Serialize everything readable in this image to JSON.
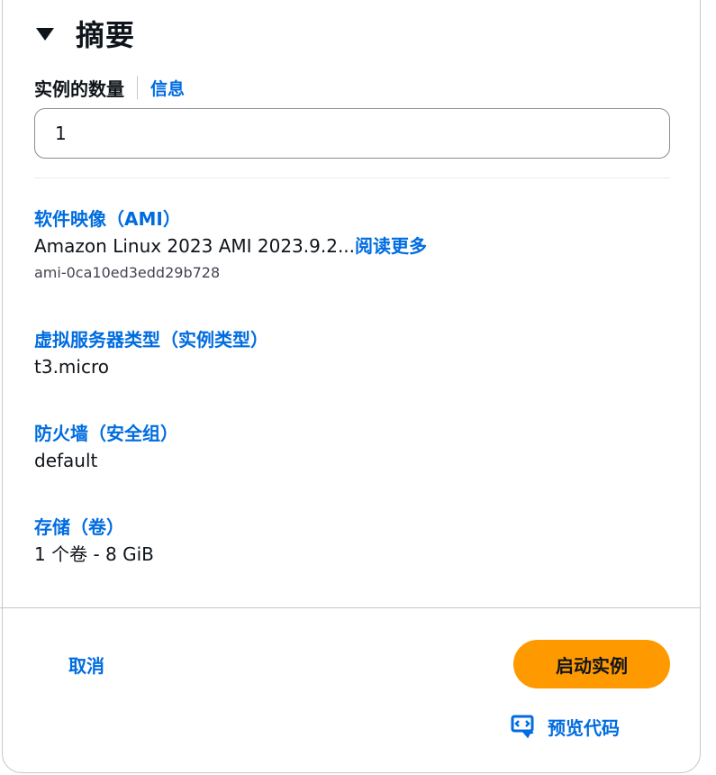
{
  "summary": {
    "title": "摘要"
  },
  "instance_count": {
    "label": "实例的数量",
    "info_link": "信息",
    "value": "1"
  },
  "ami": {
    "heading": "软件映像（AMI）",
    "value": "Amazon Linux 2023 AMI 2023.9.2...",
    "read_more": "阅读更多",
    "id": "ami-0ca10ed3edd29b728"
  },
  "instance_type": {
    "heading": "虚拟服务器类型（实例类型）",
    "value": "t3.micro"
  },
  "firewall": {
    "heading": "防火墙（安全组）",
    "value": "default"
  },
  "storage": {
    "heading": "存储（卷）",
    "value": "1 个卷 - 8 GiB"
  },
  "footer": {
    "cancel_label": "取消",
    "launch_label": "启动实例",
    "preview_label": "预览代码"
  },
  "colors": {
    "link": "#006ce0",
    "primary_button": "#ff9900",
    "text": "#0f141a"
  },
  "icons": {
    "expand": "caret-down-icon",
    "preview": "code-preview-icon"
  }
}
